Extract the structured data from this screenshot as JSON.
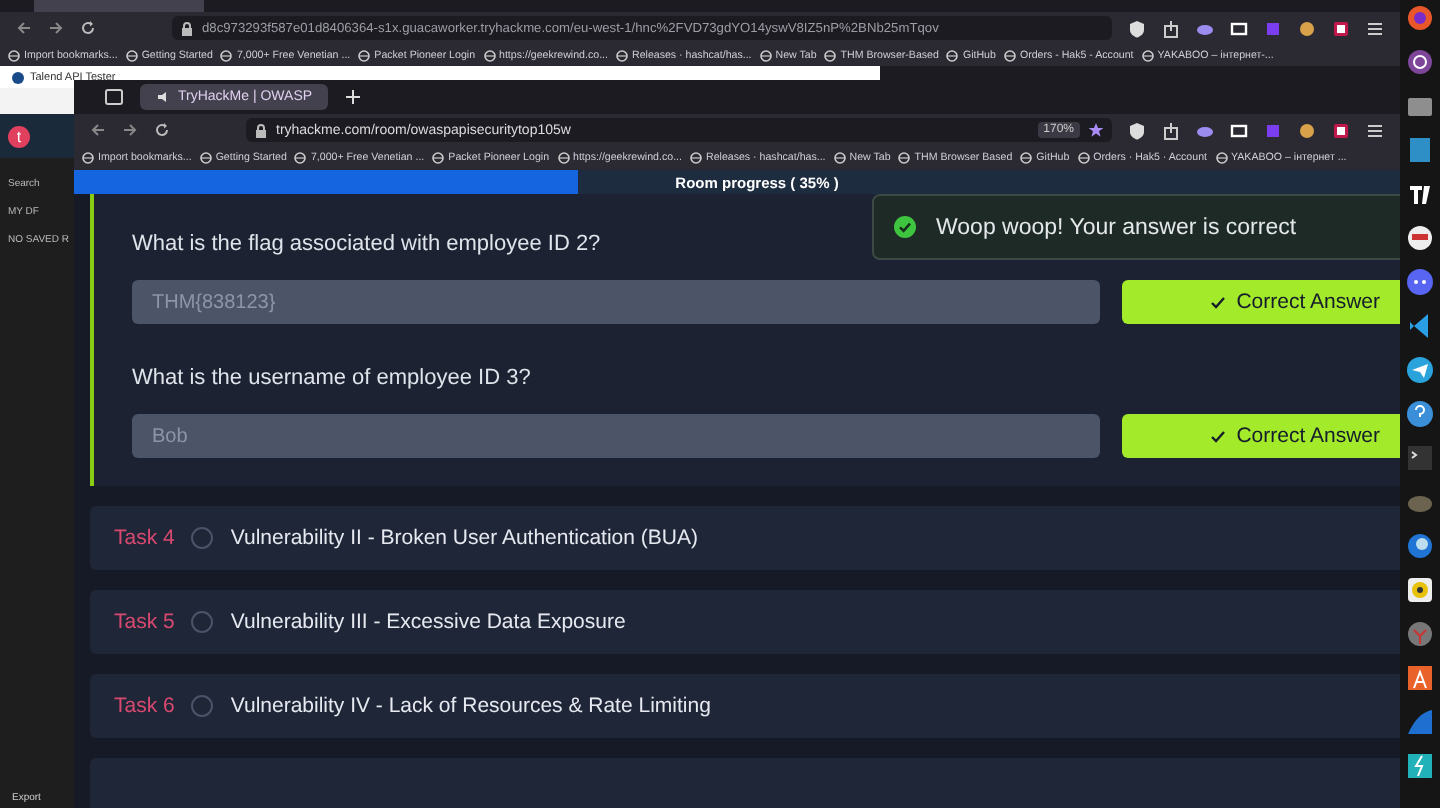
{
  "outer_browser": {
    "url": "d8c973293f587e01d8406364-s1x.guacaworker.tryhackme.com/eu-west-1/hnc%2FVD73gdYO14yswV8IZ5nP%2BNb25mTqov",
    "bookmarks": [
      "Import bookmarks...",
      "Getting Started",
      "7,000+ Free Venetian ...",
      "Packet Pioneer Login",
      "https://geekrewind.co...",
      "Releases · hashcat/has...",
      "New Tab",
      "THM Browser-Based",
      "GitHub",
      "Orders - Hak5 - Account",
      "YAKABOO – інтернет-..."
    ]
  },
  "background_window": {
    "tab": "Talend API Tester",
    "avatar": "t",
    "sidebar": [
      "Search",
      "MY DF",
      "NO SAVED R"
    ],
    "footer": "Export"
  },
  "browser": {
    "tab": "TryHackMe | OWASP",
    "url": "tryhackme.com/room/owaspapisecuritytop105w",
    "zoom": "170%",
    "bookmarks": [
      "Import bookmarks...",
      "Getting Started",
      "7,000+ Free Venetian ...",
      "Packet Pioneer Login",
      "https://geekrewind.co...",
      "Releases · hashcat/has...",
      "New Tab",
      "THM Browser Based",
      "GitHub",
      "Orders · Hak5 · Account",
      "YAKABOO – інтернет ..."
    ],
    "progress": {
      "label": "Room progress ( 35% )",
      "level": 0.38
    }
  },
  "questions": [
    {
      "question": "What is the flag associated with employee ID 2?",
      "answer": "THM{838123}",
      "button": "Correct Answer"
    },
    {
      "question": "What is the username of employee ID 3?",
      "answer": "Bob",
      "button": "Correct Answer"
    }
  ],
  "tasks": [
    {
      "label": "Task 4",
      "title": "Vulnerability II - Broken User Authentication (BUA)",
      "completed": false
    },
    {
      "label": "Task 5",
      "title": "Vulnerability III - Excessive Data Exposure",
      "completed": false
    },
    {
      "label": "Task 6",
      "title": "Vulnerability IV - Lack of Resources & Rate Limiting",
      "completed": false
    }
  ],
  "toast": {
    "message": "Woop woop! Your answer is correct"
  }
}
